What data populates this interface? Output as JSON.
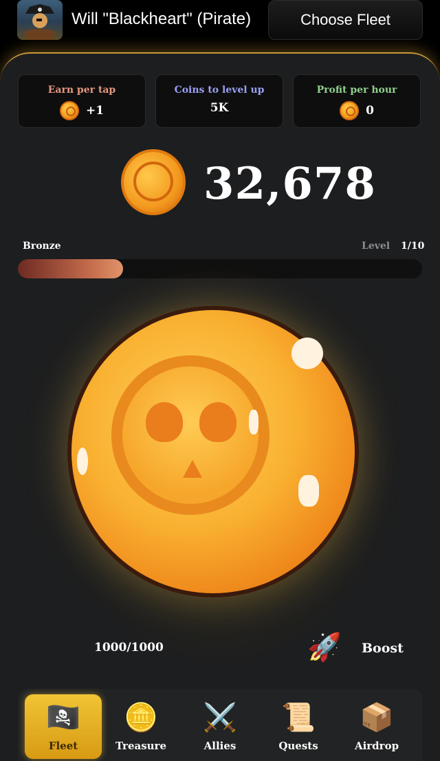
{
  "header": {
    "username": "Will \"Blackheart\" (Pirate)",
    "choose_fleet_label": "Choose  Fleet"
  },
  "stats": {
    "earn_per_tap": {
      "label": "Earn per tap",
      "value": "+1",
      "color": "#e7977f"
    },
    "coins_to_level": {
      "label": "Coins to level up",
      "value": "5K",
      "color": "#9aa0f0"
    },
    "profit_per_hour": {
      "label": "Profit per hour",
      "value": "0",
      "color": "#8fd08a"
    }
  },
  "balance": "32,678",
  "rank": {
    "name": "Bronze",
    "level_label": "Level",
    "level_value": "1/10",
    "progress": 0.26
  },
  "energy": "1000/1000",
  "boost_label": "Boost",
  "nav": [
    {
      "label": "Fleet",
      "icon": "pirate-flag-icon",
      "active": true
    },
    {
      "label": "Treasure",
      "icon": "skull-coin-icon",
      "active": false
    },
    {
      "label": "Allies",
      "icon": "crossed-swords-icon",
      "active": false
    },
    {
      "label": "Quests",
      "icon": "scroll-icon",
      "active": false
    },
    {
      "label": "Airdrop",
      "icon": "open-box-icon",
      "active": false
    }
  ]
}
